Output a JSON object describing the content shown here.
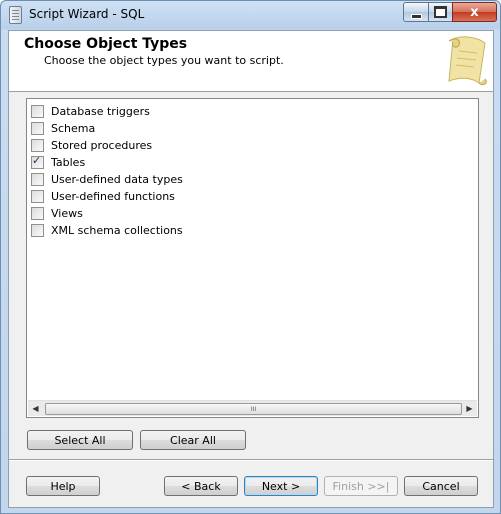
{
  "window": {
    "title": "Script Wizard - SQL"
  },
  "title_controls": {
    "close_label": "x"
  },
  "header": {
    "title": "Choose Object Types",
    "subtitle": "Choose the object types you want to script."
  },
  "object_types": [
    {
      "label": "Database triggers",
      "checked": false
    },
    {
      "label": "Schema",
      "checked": false
    },
    {
      "label": "Stored procedures",
      "checked": false
    },
    {
      "label": "Tables",
      "checked": true
    },
    {
      "label": "User-defined data types",
      "checked": false
    },
    {
      "label": "User-defined functions",
      "checked": false
    },
    {
      "label": "Views",
      "checked": false
    },
    {
      "label": "XML schema collections",
      "checked": false
    }
  ],
  "scrollbar": {
    "left_arrow": "◀",
    "right_arrow": "▶",
    "grip": "III"
  },
  "selection_buttons": {
    "select_all": "Select All",
    "clear_all": "Clear All"
  },
  "footer_buttons": {
    "help": "Help",
    "back": "< Back",
    "next": "Next >",
    "finish": "Finish >>|",
    "cancel": "Cancel"
  },
  "colors": {
    "accent": "#3c7fb1",
    "close": "#c23b1f",
    "titlebar": "#b9d0ea"
  }
}
